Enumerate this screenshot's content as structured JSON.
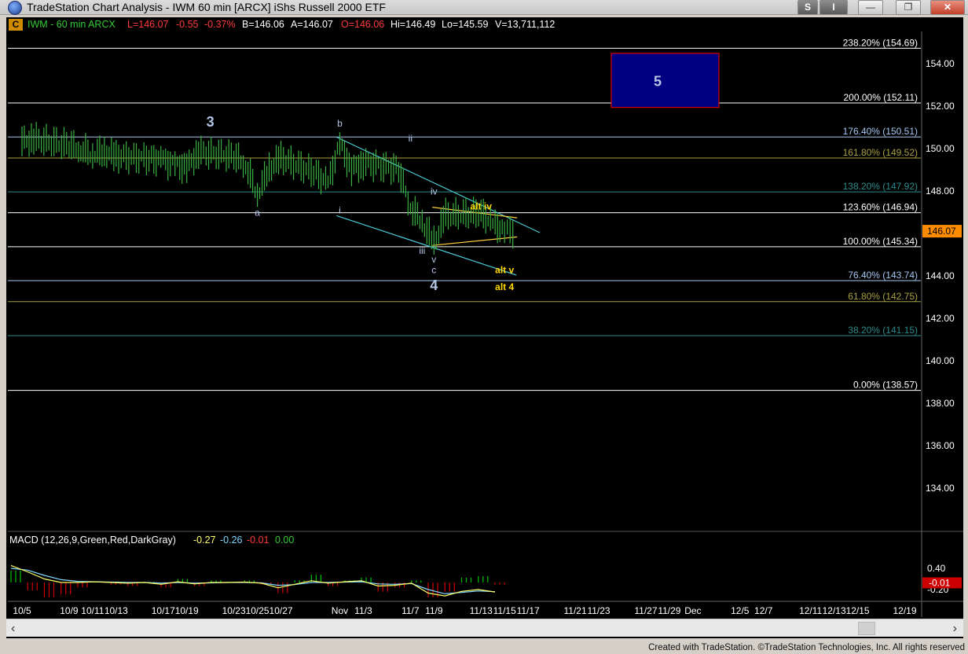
{
  "window": {
    "title": "TradeStation Chart Analysis - IWM 60 min [ARCX] iShs Russell 2000 ETF",
    "buttons": {
      "s": "S",
      "i": "I",
      "minimize": "—",
      "restore": "❐",
      "close": "✕"
    }
  },
  "header": {
    "c_badge": "C",
    "symbol": "IWM - 60 min  ARCX",
    "last": "L=146.07",
    "change": "-0.55",
    "change_pct": "-0.37%",
    "bid": "B=146.06",
    "ask": "A=146.07",
    "open": "O=146.06",
    "high": "Hi=146.49",
    "low": "Lo=145.59",
    "volume": "V=13,711,112"
  },
  "macd_header": {
    "name": "MACD (12,26,9,Green,Red,DarkGray)",
    "macd": "-0.27",
    "signal": "-0.26",
    "hist": "-0.01",
    "zero": "0.00"
  },
  "footer": "Created with TradeStation. ©TradeStation Technologies, Inc. All rights reserved",
  "colors": {
    "background": "#000000",
    "price_bars": "#3cb043",
    "fib_white": "#ffffff",
    "fib_cyan": "#4cc9d6",
    "fib_olive": "#a8a040",
    "fib_teal": "#2e8b8b",
    "wave_label": "#b4c6e7",
    "alt_label": "#ffd700",
    "target_box": "#000080",
    "target_border": "#ff0000",
    "last_price_tag": "#ff8c00",
    "macd_line": "#ffff66",
    "signal_line": "#7fd6ff",
    "hist_pos": "#00c000",
    "hist_neg": "#d00000"
  },
  "chart_data": {
    "type": "line",
    "title": "IWM 60 min",
    "x_tick_labels": [
      "10/5",
      "10/9",
      "10/11",
      "10/13",
      "10/17",
      "10/19",
      "10/23",
      "10/25",
      "10/27",
      "Nov",
      "11/3",
      "11/7",
      "11/9",
      "11/13",
      "11/15",
      "11/17",
      "11/21",
      "11/23",
      "11/27",
      "11/29",
      "Dec",
      "12/5",
      "12/7",
      "12/11",
      "12/13",
      "12/15",
      "12/19"
    ],
    "y_tick_labels": [
      "154.00",
      "152.00",
      "150.00",
      "148.00",
      "146.00",
      "144.00",
      "142.00",
      "140.00",
      "138.00",
      "136.00",
      "134.00"
    ],
    "ylim": [
      132.0,
      155.2
    ],
    "last_price": "146.07",
    "series": [
      {
        "name": "IWM",
        "points": [
          [
            "10/5",
            150.3
          ],
          [
            "10/6",
            150.4
          ],
          [
            "10/9",
            150.1
          ],
          [
            "10/10",
            149.9
          ],
          [
            "10/11",
            149.7
          ],
          [
            "10/12",
            149.8
          ],
          [
            "10/13",
            149.6
          ],
          [
            "10/16",
            149.5
          ],
          [
            "10/17",
            149.4
          ],
          [
            "10/18",
            149.2
          ],
          [
            "10/19",
            149.1
          ],
          [
            "10/20",
            149.8
          ],
          [
            "10/23",
            149.6
          ],
          [
            "10/24",
            149.2
          ],
          [
            "10/25",
            147.8
          ],
          [
            "10/26",
            149.0
          ],
          [
            "10/27",
            149.5
          ],
          [
            "10/30",
            148.8
          ],
          [
            "10/31",
            148.3
          ],
          [
            "11/1",
            150.2
          ],
          [
            "11/2",
            149.0
          ],
          [
            "11/3",
            149.3
          ],
          [
            "11/6",
            149.0
          ],
          [
            "11/7",
            147.2
          ],
          [
            "11/8",
            146.5
          ],
          [
            "11/9",
            145.5
          ],
          [
            "11/10",
            146.8
          ],
          [
            "11/13",
            146.9
          ],
          [
            "11/14",
            146.4
          ],
          [
            "11/15",
            146.1
          ]
        ]
      }
    ],
    "fib_levels": [
      {
        "label": "238.20% (154.69)",
        "value": 154.69
      },
      {
        "label": "200.00% (152.11)",
        "value": 152.11
      },
      {
        "label": "176.40% (150.51)",
        "value": 150.51
      },
      {
        "label": "161.80% (149.52)",
        "value": 149.52
      },
      {
        "label": "138.20% (147.92)",
        "value": 147.92
      },
      {
        "label": "123.60% (146.94)",
        "value": 146.94
      },
      {
        "label": "100.00% (145.34)",
        "value": 145.34
      },
      {
        "label": "76.40% (143.74)",
        "value": 143.74
      },
      {
        "label": "61.80% (142.75)",
        "value": 142.75
      },
      {
        "label": "38.20% (141.15)",
        "value": 141.15
      },
      {
        "label": "0.00% (138.57)",
        "value": 138.57
      }
    ],
    "target_zone": {
      "label": "5",
      "x_start": "11/27",
      "x_end": "12/1",
      "y_top": 154.45,
      "y_bottom": 151.9
    },
    "wave_labels": [
      {
        "text": "3",
        "x": "10/21",
        "y": 151.0,
        "size": "large"
      },
      {
        "text": "b",
        "x": "11/1",
        "y": 151.0
      },
      {
        "text": "ii",
        "x": "11/7",
        "y": 150.3
      },
      {
        "text": "a",
        "x": "10/25",
        "y": 146.8
      },
      {
        "text": "i",
        "x": "11/1",
        "y": 146.9
      },
      {
        "text": "iv",
        "x": "11/9",
        "y": 147.8
      },
      {
        "text": "alt iv",
        "x": "11/13",
        "y": 147.1,
        "alt": true
      },
      {
        "text": "iii",
        "x": "11/8",
        "y": 145.0
      },
      {
        "text": "v",
        "x": "11/9",
        "y": 144.6
      },
      {
        "text": "c",
        "x": "11/9",
        "y": 144.1
      },
      {
        "text": "4",
        "x": "11/9",
        "y": 143.3,
        "size": "large"
      },
      {
        "text": "alt v",
        "x": "11/15",
        "y": 144.1,
        "alt": true
      },
      {
        "text": "alt 4",
        "x": "11/15",
        "y": 143.3,
        "alt": true
      }
    ],
    "channel_lines": [
      {
        "x1": "11/1",
        "y1": 150.5,
        "x2": "11/17",
        "y2": 146.0
      },
      {
        "x1": "11/1",
        "y1": 146.8,
        "x2": "11/15",
        "y2": 144.0
      }
    ],
    "triangle_lines": [
      {
        "x1": "11/9",
        "y1": 147.2,
        "x2": "11/15",
        "y2": 146.7
      },
      {
        "x1": "11/9",
        "y1": 145.4,
        "x2": "11/15",
        "y2": 145.8
      }
    ],
    "macd": {
      "y_tick_labels": [
        "0.40",
        "-0.20"
      ],
      "ylim": [
        -0.4,
        0.6
      ],
      "last_value": "-0.01",
      "macd_values": [
        0.48,
        0.3,
        0.1,
        0.0,
        0.0,
        0.02,
        0.0,
        -0.02,
        0.0,
        -0.05,
        0.02,
        -0.04,
        0.0,
        0.0,
        0.01,
        -0.02,
        -0.15,
        -0.05,
        0.05,
        -0.02,
        0.02,
        0.05,
        -0.1,
        -0.08,
        -0.02,
        -0.3,
        -0.38,
        -0.25,
        -0.2,
        -0.27
      ],
      "signal_values": [
        0.4,
        0.35,
        0.2,
        0.08,
        0.03,
        0.02,
        0.01,
        0.0,
        0.0,
        -0.02,
        0.0,
        -0.02,
        -0.01,
        0.0,
        0.0,
        -0.01,
        -0.08,
        -0.06,
        0.0,
        0.0,
        0.01,
        0.02,
        -0.04,
        -0.05,
        -0.03,
        -0.2,
        -0.32,
        -0.28,
        -0.24,
        -0.26
      ]
    }
  }
}
